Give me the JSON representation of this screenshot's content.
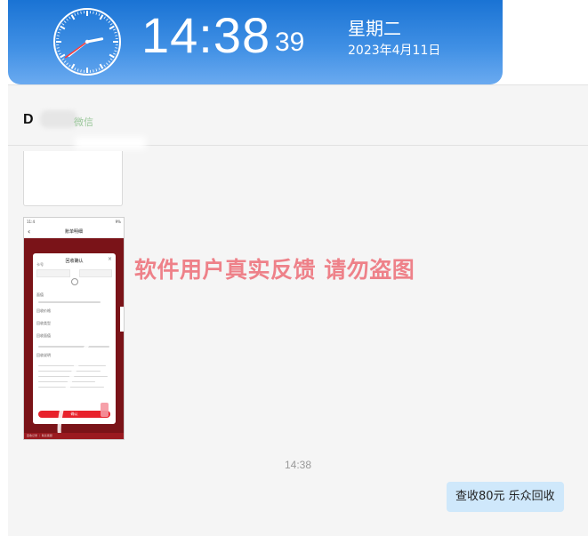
{
  "clock": {
    "time": "14:38",
    "seconds": "39",
    "weekday": "星期二",
    "date": "2023年4月11日"
  },
  "chat": {
    "contact_name": "D",
    "contact_tag": "微信",
    "message_time": "14:38",
    "outgoing_message": "查收80元  乐众回收"
  },
  "screenshot_message": {
    "status_left": "11:4",
    "status_right": "9%",
    "page_title": "账单明细",
    "dialog_title": "回收确认",
    "rows": [
      "卡号",
      "面值",
      "回收价格",
      "回收类型",
      "回收面值",
      "回收说明"
    ],
    "confirm_button": "确认",
    "bottom_note": "回收记录 ｜ 联系客服"
  },
  "watermark": "软件用户真实反馈  请勿盗图",
  "colors": {
    "banner_top": "#1a73d4",
    "banner_bottom": "#6aaaf0",
    "bubble_bg": "#cfe8fb",
    "watermark": "#ec606a"
  }
}
